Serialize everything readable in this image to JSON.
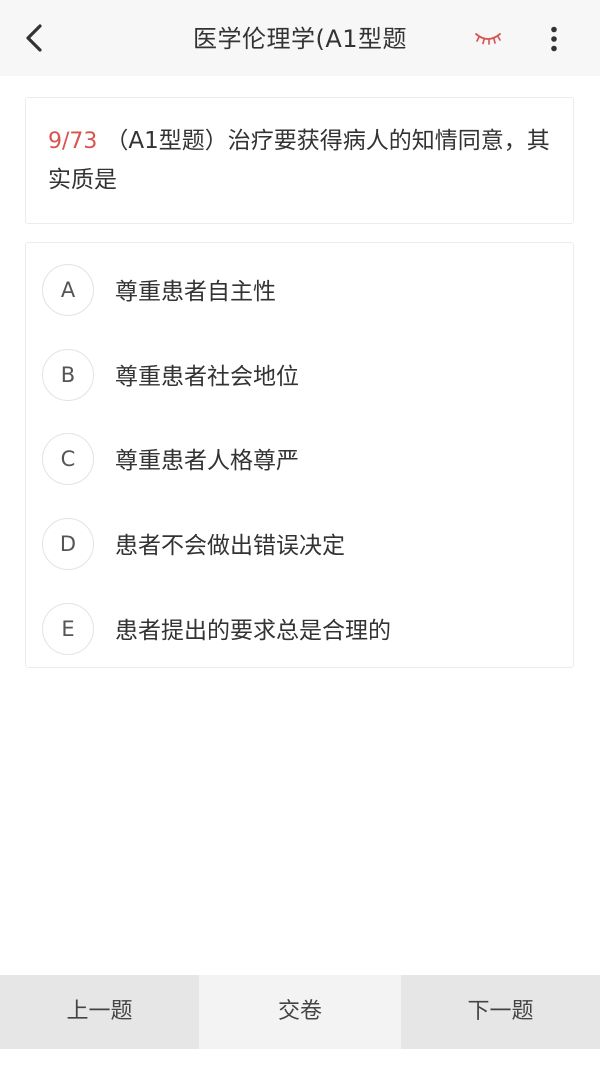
{
  "header": {
    "title": "医学伦理学(A1型题",
    "back_icon": "chevron-left-icon",
    "eye_icon": "closed-eye-icon",
    "more_icon": "more-vertical-icon"
  },
  "question": {
    "counter": "9/73",
    "text": "（A1型题）治疗要获得病人的知情同意，其实质是"
  },
  "options": [
    {
      "letter": "A",
      "text": "尊重患者自主性"
    },
    {
      "letter": "B",
      "text": "尊重患者社会地位"
    },
    {
      "letter": "C",
      "text": "尊重患者人格尊严"
    },
    {
      "letter": "D",
      "text": "患者不会做出错误决定"
    },
    {
      "letter": "E",
      "text": "患者提出的要求总是合理的"
    }
  ],
  "footer": {
    "prev_label": "上一题",
    "submit_label": "交卷",
    "next_label": "下一题"
  },
  "colors": {
    "accent": "#d9534f",
    "header_bg": "#f7f7f7",
    "footer_bg": "#e6e6e6"
  }
}
